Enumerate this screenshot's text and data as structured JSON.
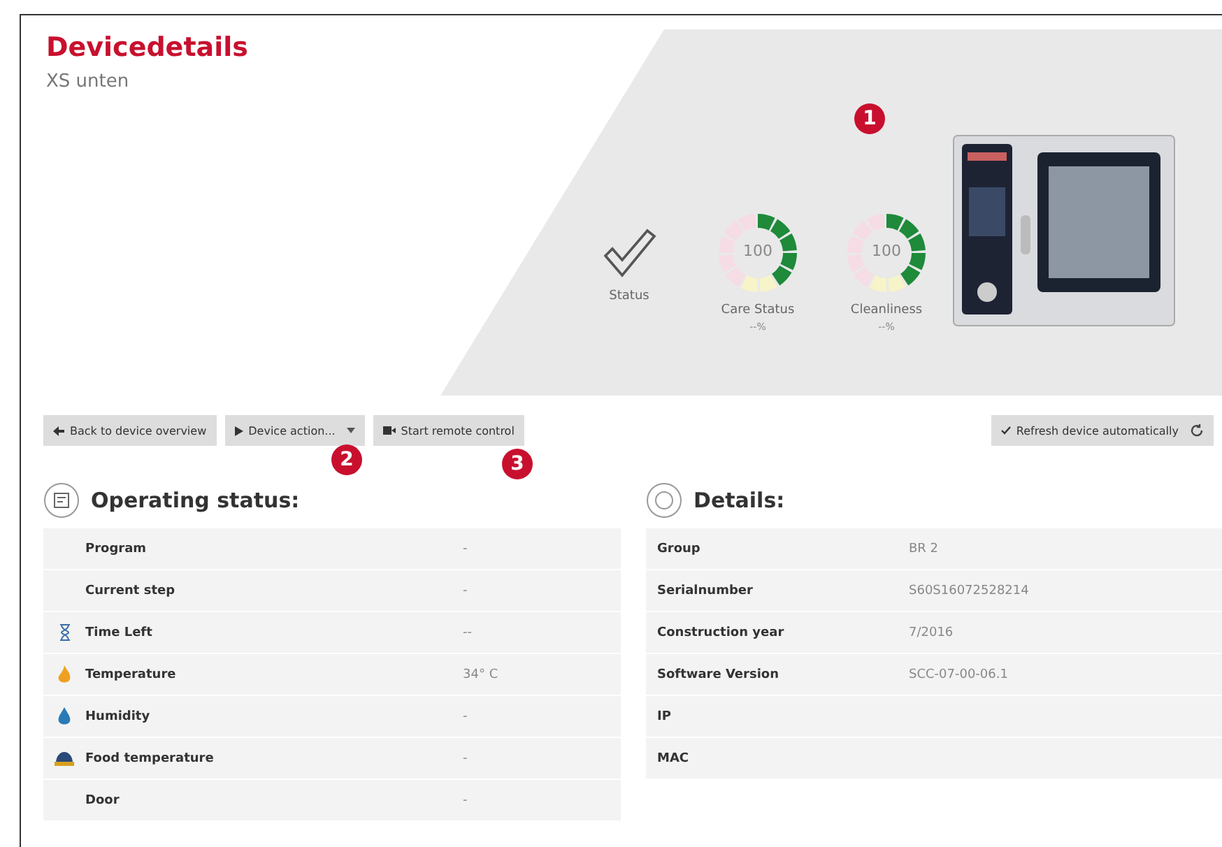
{
  "header": {
    "title": "Devicedetails",
    "subtitle": "XS unten"
  },
  "indicators": [
    {
      "kind": "check",
      "label": "Status"
    },
    {
      "kind": "gauge",
      "value": "100",
      "label": "Care Status",
      "reading": "--%"
    },
    {
      "kind": "gauge",
      "value": "100",
      "label": "Cleanliness",
      "reading": "--%"
    }
  ],
  "callouts": [
    "1",
    "2",
    "3"
  ],
  "toolbar": {
    "back": "Back to device overview",
    "actions": "Device action...",
    "remote": "Start remote control",
    "refresh": {
      "label": "Refresh device automatically",
      "checked": true
    }
  },
  "operating_status": {
    "title": "Operating status:",
    "rows": [
      {
        "kind": "plain",
        "label": "Program",
        "value": "-"
      },
      {
        "kind": "plain",
        "label": "Current step",
        "value": "-"
      },
      {
        "kind": "timer",
        "label": "Time Left",
        "value": "--"
      },
      {
        "kind": "temperature",
        "label": "Temperature",
        "value": "34° C"
      },
      {
        "kind": "humidity",
        "label": "Humidity",
        "value": "-"
      },
      {
        "kind": "food",
        "label": "Food temperature",
        "value": "-"
      },
      {
        "kind": "plain",
        "label": "Door",
        "value": "-"
      }
    ]
  },
  "details": {
    "title": "Details:",
    "rows": [
      {
        "label": "Group",
        "value": "BR 2"
      },
      {
        "label": "Serialnumber",
        "value": "S60S16072528214"
      },
      {
        "label": "Construction year",
        "value": "7/2016"
      },
      {
        "label": "Software Version",
        "value": "SCC-07-00-06.1"
      },
      {
        "label": "IP"
      },
      {
        "label": "MAC"
      }
    ]
  }
}
